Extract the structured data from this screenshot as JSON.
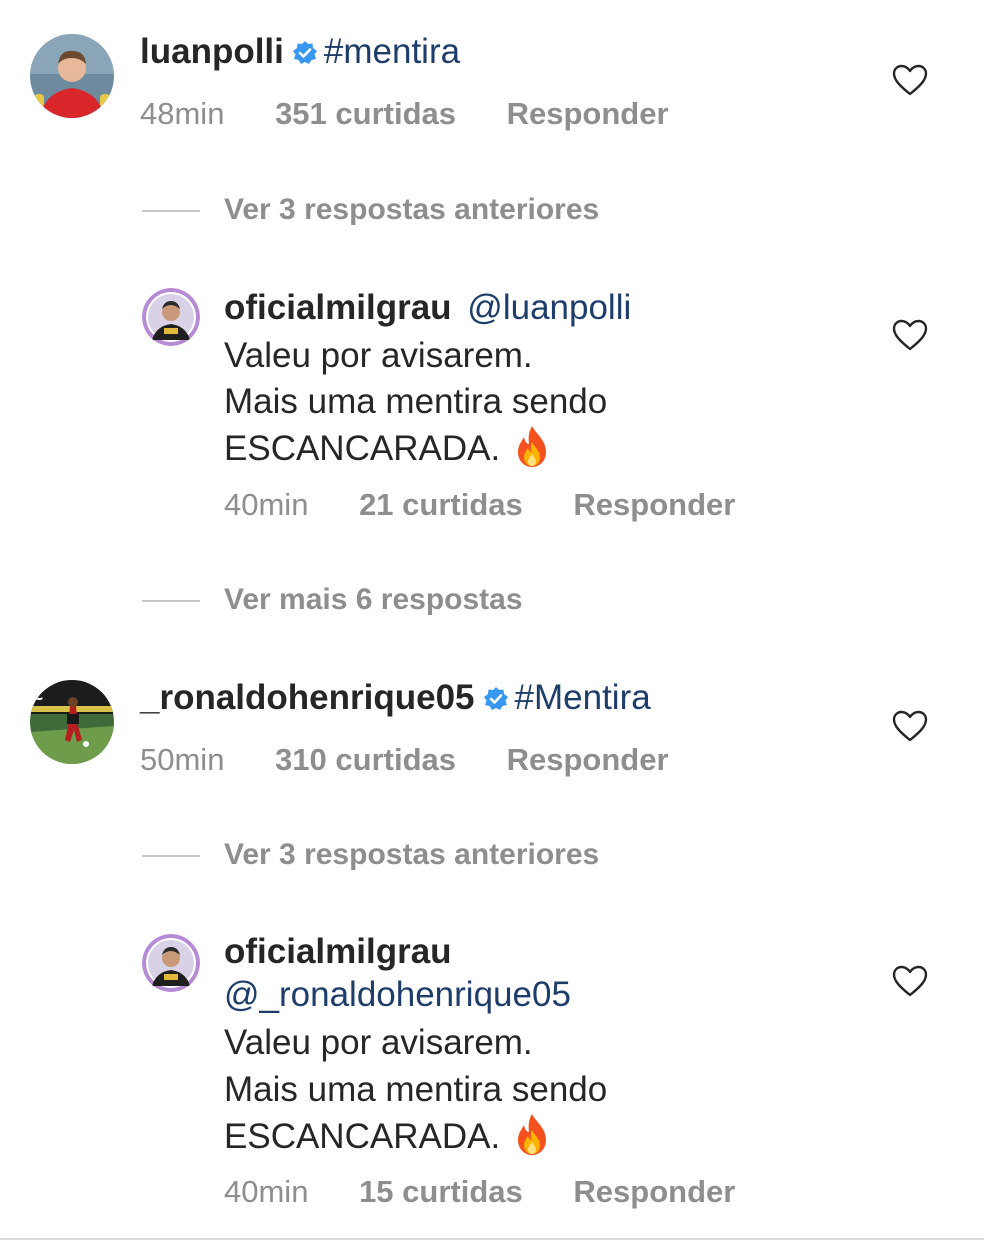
{
  "comments": [
    {
      "username": "luanpolli",
      "verified": true,
      "text": "#mentira",
      "time": "48min",
      "likes": "351 curtidas",
      "reply_label": "Responder",
      "view_replies": "Ver 3 respostas anteriores",
      "reply": {
        "username": "oficialmilgrau",
        "mention": "@luanpolli",
        "line1": "Valeu por avisarem.",
        "line2": "Mais uma mentira sendo",
        "line3": "ESCANCARADA.",
        "emoji": "fire-icon",
        "time": "40min",
        "likes": "21 curtidas",
        "reply_label": "Responder"
      },
      "view_more": "Ver mais 6 respostas"
    },
    {
      "username": "_ronaldohenrique05",
      "verified": true,
      "text": "#Mentira",
      "time": "50min",
      "likes": "310 curtidas",
      "reply_label": "Responder",
      "view_replies": "Ver 3 respostas anteriores",
      "reply": {
        "username": "oficialmilgrau",
        "mention": "@_ronaldohenrique05",
        "line1": "Valeu por avisarem.",
        "line2": "Mais uma mentira sendo",
        "line3": "ESCANCARADA.",
        "emoji": "fire-icon",
        "time": "40min",
        "likes": "15 curtidas",
        "reply_label": "Responder"
      }
    }
  ],
  "colors": {
    "text": "#262626",
    "meta": "#8e8e8e",
    "hashtag_mention": "#1e3d6b",
    "verified_badge": "#3897f0"
  }
}
